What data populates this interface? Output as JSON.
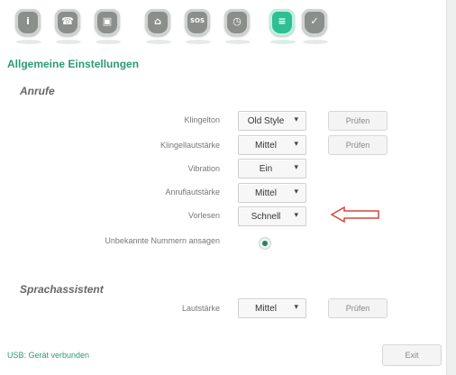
{
  "toolbar": {
    "icons": [
      {
        "name": "info-icon",
        "glyph": "i",
        "active": false
      },
      {
        "name": "phone-icon",
        "glyph": "☎",
        "active": false
      },
      {
        "name": "display-icon",
        "glyph": "▣",
        "active": false
      },
      {
        "name": "contacts-icon",
        "glyph": "⌂",
        "active": false
      },
      {
        "name": "sos-icon",
        "glyph": "SOS",
        "active": false
      },
      {
        "name": "clock-icon",
        "glyph": "◷",
        "active": false
      },
      {
        "name": "settings-icon",
        "glyph": "≡",
        "active": true
      },
      {
        "name": "check-icon",
        "glyph": "✓",
        "active": false
      }
    ],
    "colors": {
      "inactive": "#8a8f8c",
      "active": "#2fbf93"
    }
  },
  "page": {
    "title": "Allgemeine Einstellungen"
  },
  "calls": {
    "title": "Anrufe",
    "ringtone": {
      "label": "Klingelton",
      "value": "Old Style",
      "test": "Prüfen"
    },
    "ring_volume": {
      "label": "Klingellautstärke",
      "value": "Mittel",
      "test": "Prüfen"
    },
    "vibration": {
      "label": "Vibration",
      "value": "Ein"
    },
    "call_volume": {
      "label": "Anruflautstärke",
      "value": "Mittel"
    },
    "read_aloud": {
      "label": "Vorlesen",
      "value": "Schnell"
    },
    "announce_unknown": {
      "label": "Unbekannte Nummern ansagen",
      "checked": true
    }
  },
  "assistant": {
    "title": "Sprachassistent",
    "volume": {
      "label": "Lautstärke",
      "value": "Mittel",
      "test": "Prüfen"
    }
  },
  "status": {
    "usb": "USB: Gerät verbunden"
  },
  "exit": "Exit",
  "accent": "#2b9a76",
  "arrow_color": "#d9463a"
}
